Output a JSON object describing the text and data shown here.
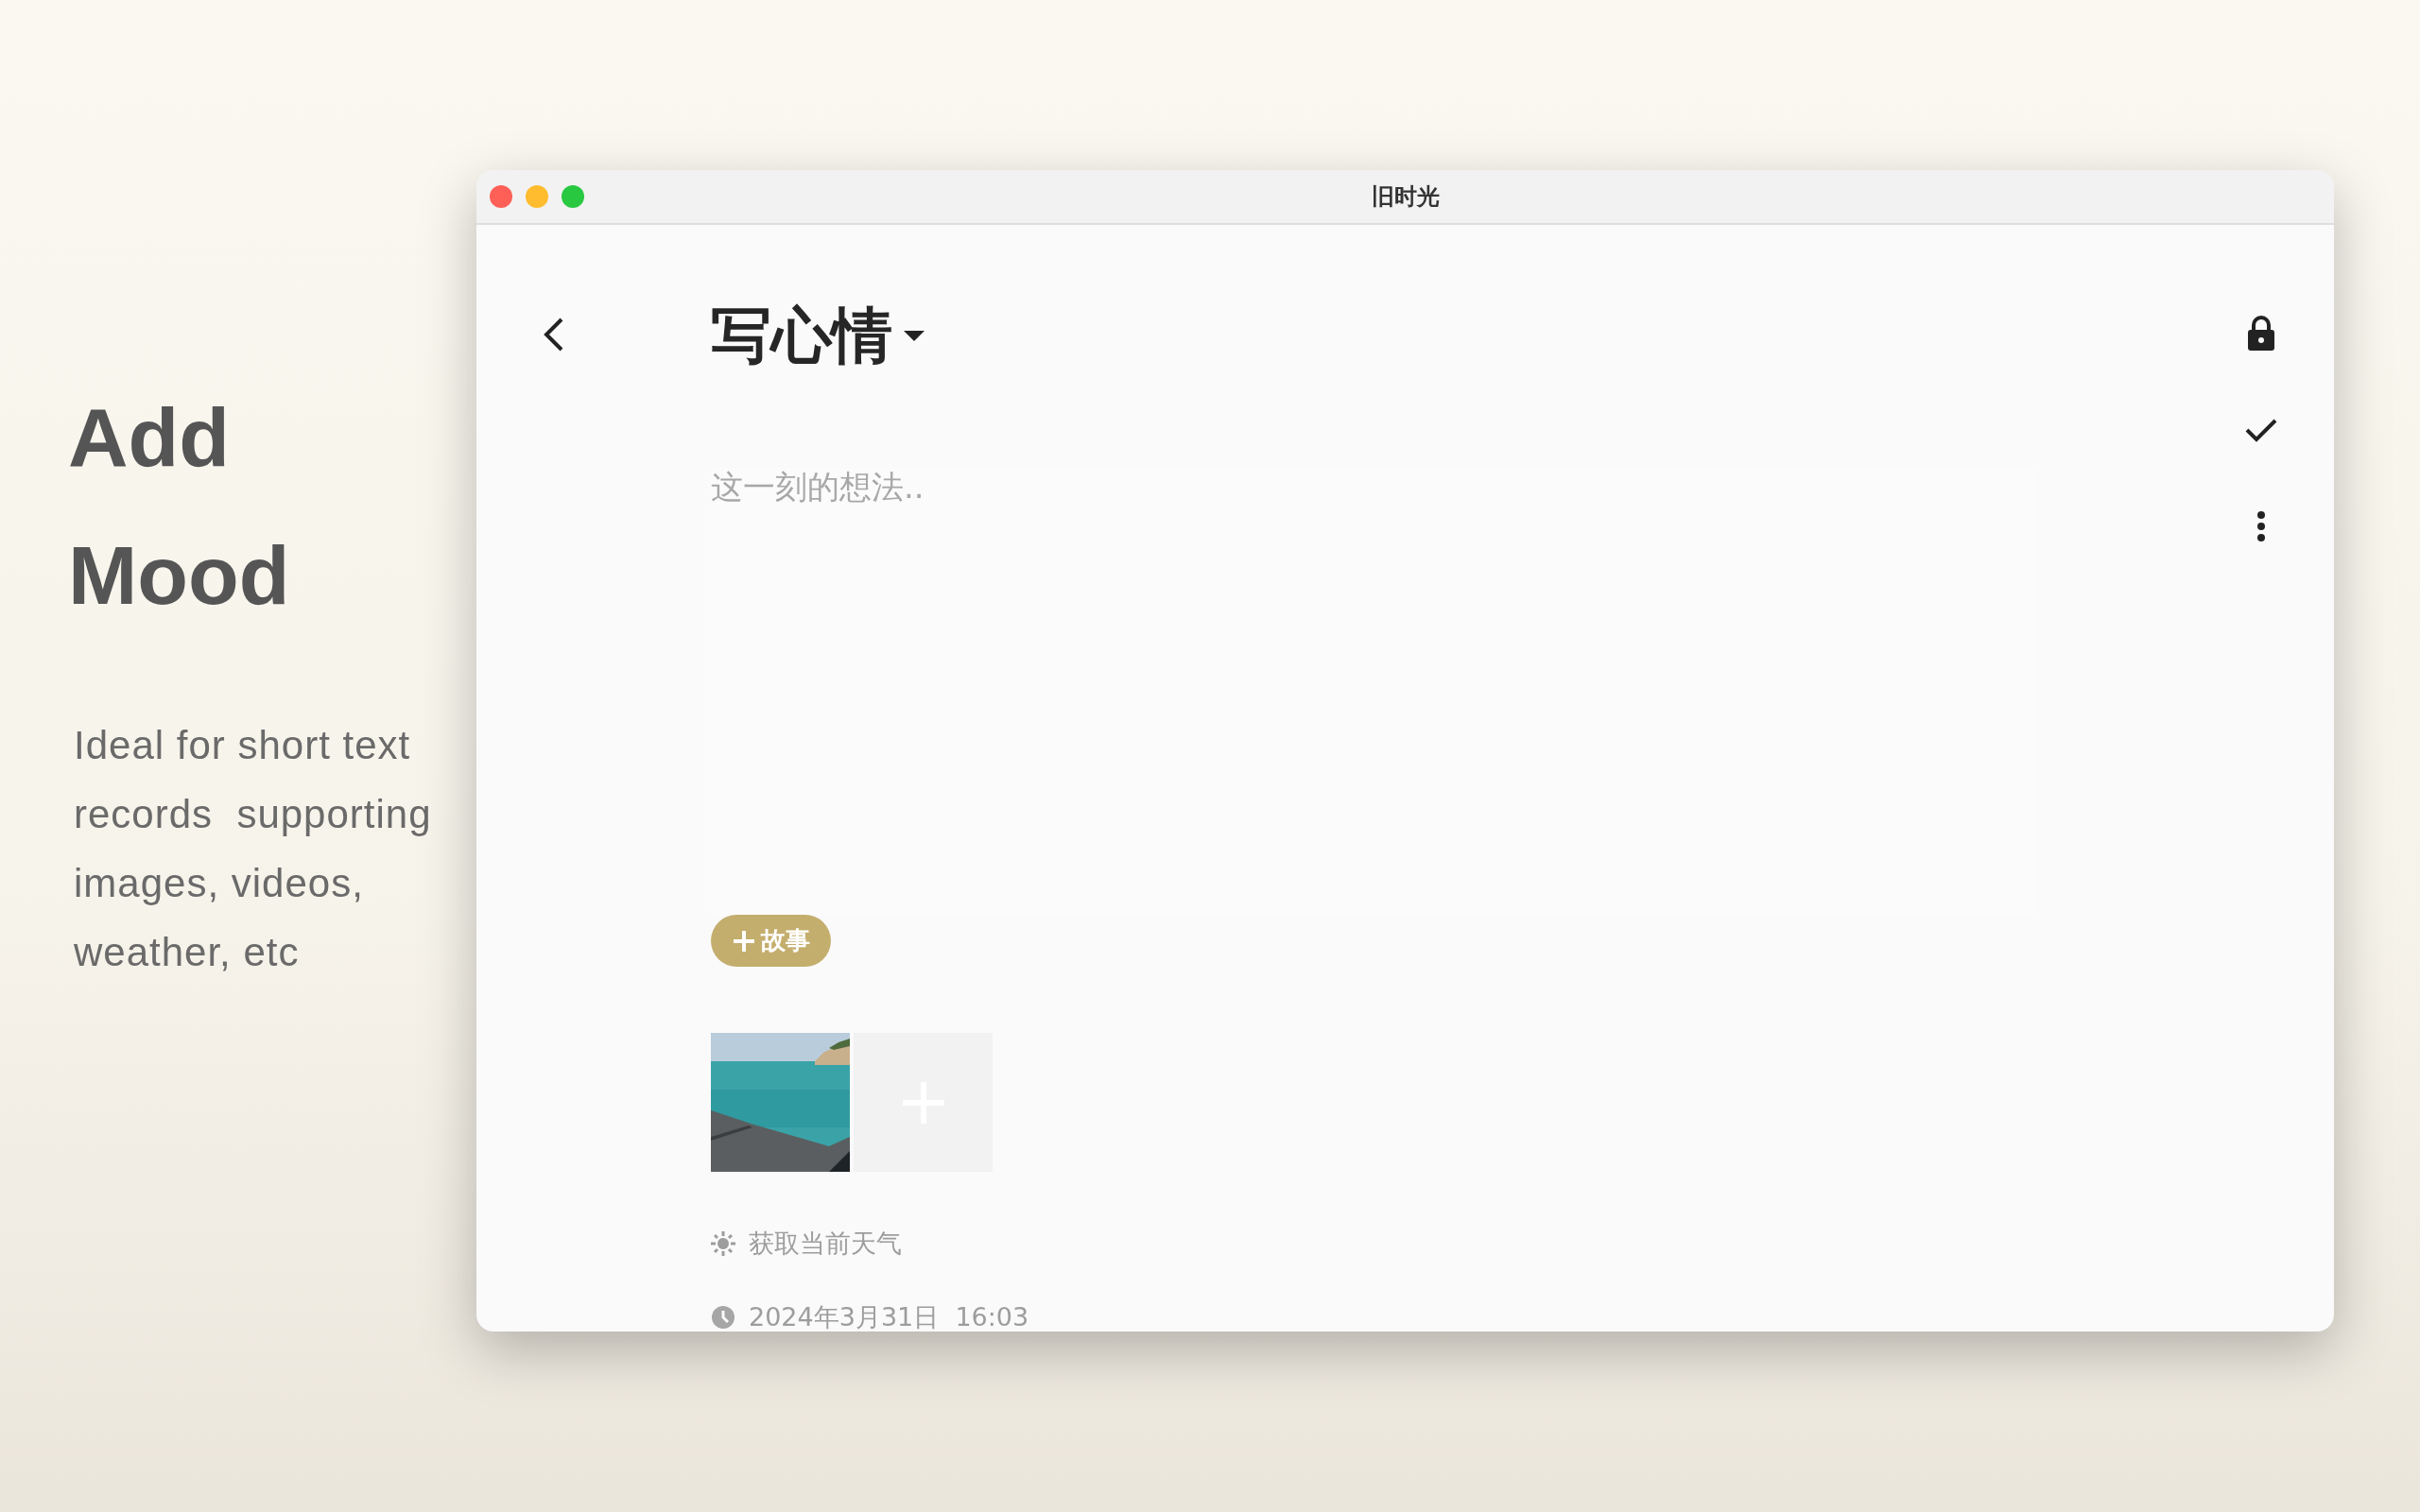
{
  "promo": {
    "title_lines": [
      "Add",
      "Mood"
    ],
    "description_lines": [
      "Ideal for short text",
      "records  supporting",
      "images, videos,",
      "weather, etc"
    ]
  },
  "window": {
    "title": "旧时光"
  },
  "editor": {
    "heading": "写心情",
    "placeholder": "这一刻的想法..",
    "story_button": "故事",
    "media": [
      {
        "kind": "picture"
      },
      {
        "kind": "add"
      }
    ],
    "weather": "获取当前天气",
    "datetime": "2024年3月31日  16:03"
  }
}
